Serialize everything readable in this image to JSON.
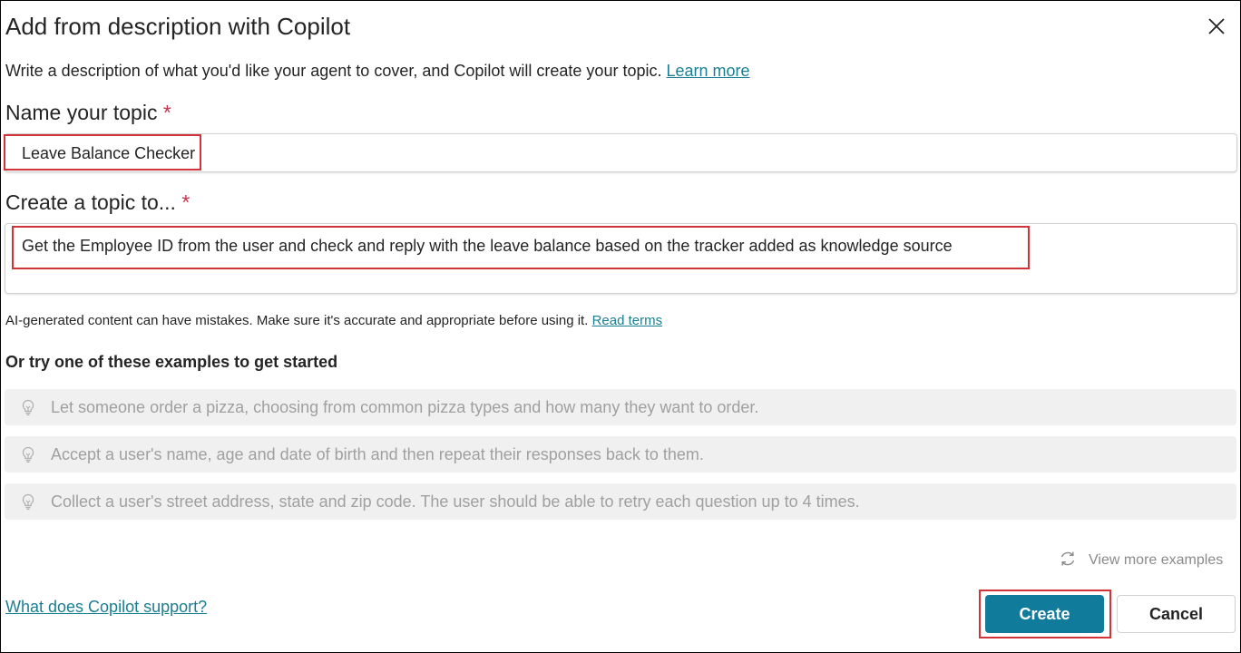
{
  "dialog": {
    "title": "Add from description with Copilot",
    "close_icon": "close-icon",
    "description": "Write a description of what you'd like your agent to cover, and Copilot will create your topic.",
    "learn_more": "Learn more"
  },
  "name_field": {
    "label": "Name your topic",
    "required_mark": "*",
    "value": "Leave Balance Checker"
  },
  "topic_field": {
    "label": "Create a topic to...",
    "required_mark": "*",
    "value": "Get the Employee ID from the user and check and reply with the leave balance based on the tracker added as knowledge source"
  },
  "disclaimer": {
    "text": "AI-generated content can have mistakes. Make sure it's accurate and appropriate before using it.",
    "link": "Read terms"
  },
  "examples": {
    "heading": "Or try one of these examples to get started",
    "icon": "lightbulb-icon",
    "items": [
      "Let someone order a pizza, choosing from common pizza types and how many they want to order.",
      "Accept a user's name, age and date of birth and then repeat their responses back to them.",
      "Collect a user's street address, state and zip code. The user should be able to retry each question up to 4 times."
    ],
    "view_more": "View more examples",
    "view_more_icon": "refresh-icon"
  },
  "footer": {
    "support_link": "What does Copilot support?",
    "create_label": "Create",
    "cancel_label": "Cancel"
  },
  "colors": {
    "primary": "#117b9c",
    "highlight": "#d13438",
    "required": "#c4314b",
    "link": "#0f6cbd"
  }
}
